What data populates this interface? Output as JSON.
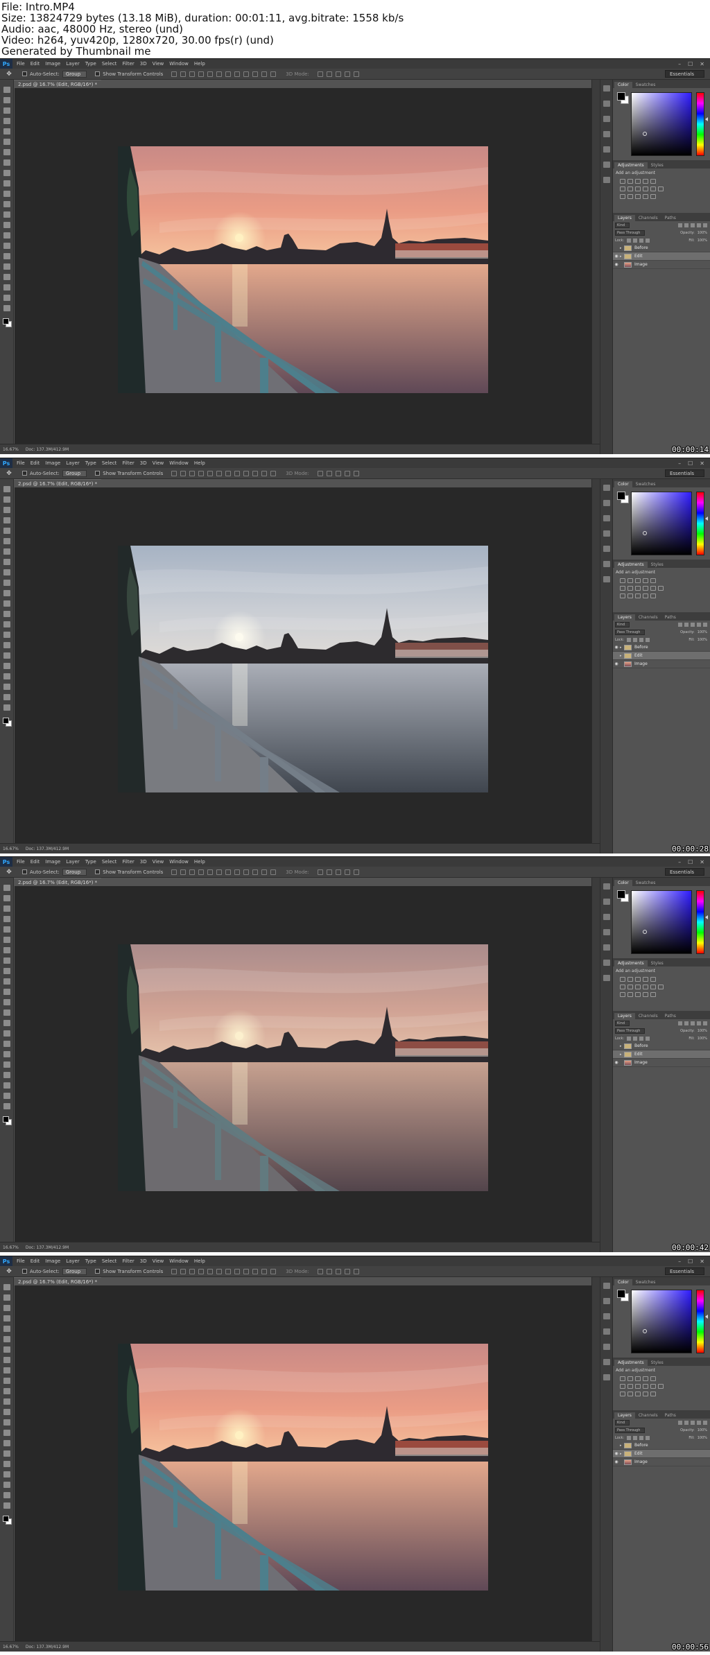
{
  "info": {
    "file_line": "File: Intro.MP4",
    "size_line": "Size: 13824729 bytes (13.18 MiB), duration: 00:01:11, avg.bitrate: 1558 kb/s",
    "audio_line": "Audio: aac, 48000 Hz, stereo (und)",
    "video_line": "Video: h264, yuv420p, 1280x720, 30.00 fps(r) (und)",
    "generator_line": "Generated by Thumbnail me"
  },
  "app": {
    "logo": "Ps",
    "menu": [
      "File",
      "Edit",
      "Image",
      "Layer",
      "Type",
      "Select",
      "Filter",
      "3D",
      "View",
      "Window",
      "Help"
    ],
    "window_buttons": [
      "–",
      "☐",
      "✕"
    ]
  },
  "options_bar": {
    "auto_select_label": "Auto-Select:",
    "auto_select_value": "Group",
    "transform_controls_label": "Show Transform Controls",
    "mode_3d_label": "3D Mode:",
    "workspace": "Essentials"
  },
  "document": {
    "tab_title": "2.psd @ 16.7% (Edit, RGB/16*) *",
    "zoom": "16.67%",
    "doc_size": "Doc: 137.3M/412.9M"
  },
  "panels": {
    "color_tabs": [
      "Color",
      "Swatches"
    ],
    "adjust_tabs": [
      "Adjustments",
      "Styles"
    ],
    "add_adjustment": "Add an adjustment",
    "layers_tabs": [
      "Layers",
      "Channels",
      "Paths"
    ],
    "kind_label": "Kind",
    "blend_mode": "Pass Through",
    "opacity_label": "Opacity:",
    "opacity_value": "100%",
    "lock_label": "Lock:",
    "fill_label": "Fill:",
    "fill_value": "100%"
  },
  "frames": [
    {
      "timestamp": "00:00:14",
      "variant": "warm",
      "photo_saturation": 1.0,
      "layers": [
        {
          "name": "Before",
          "visible": false,
          "selected": false,
          "thumb": "folder",
          "has_arrow": true
        },
        {
          "name": "Edit",
          "visible": true,
          "selected": true,
          "thumb": "folder",
          "has_arrow": true
        },
        {
          "name": "Image",
          "visible": true,
          "selected": false,
          "thumb": "image",
          "has_arrow": false
        }
      ]
    },
    {
      "timestamp": "00:00:28",
      "variant": "cool",
      "photo_saturation": 0.6,
      "layers": [
        {
          "name": "Before",
          "visible": true,
          "selected": false,
          "thumb": "folder",
          "has_arrow": true
        },
        {
          "name": "Edit",
          "visible": false,
          "selected": true,
          "thumb": "folder",
          "has_arrow": true
        },
        {
          "name": "Image",
          "visible": true,
          "selected": false,
          "thumb": "image",
          "has_arrow": false
        }
      ]
    },
    {
      "timestamp": "00:00:42",
      "variant": "muted",
      "photo_saturation": 0.8,
      "layers": [
        {
          "name": "Before",
          "visible": false,
          "selected": false,
          "thumb": "folder",
          "has_arrow": true
        },
        {
          "name": "Edit",
          "visible": false,
          "selected": true,
          "thumb": "folder",
          "has_arrow": true
        },
        {
          "name": "Image",
          "visible": true,
          "selected": false,
          "thumb": "image",
          "has_arrow": false
        }
      ]
    },
    {
      "timestamp": "00:00:56",
      "variant": "warm",
      "photo_saturation": 1.0,
      "layers": [
        {
          "name": "Before",
          "visible": false,
          "selected": false,
          "thumb": "folder",
          "has_arrow": true
        },
        {
          "name": "Edit",
          "visible": true,
          "selected": true,
          "thumb": "folder",
          "has_arrow": true
        },
        {
          "name": "Image",
          "visible": true,
          "selected": false,
          "thumb": "image",
          "has_arrow": false
        }
      ]
    }
  ],
  "palettes": {
    "warm": {
      "sky_top": "#c98a86",
      "sky_mid": "#ea9c85",
      "sky_bottom": "#f7c7a0",
      "water_top": "#e3a88c",
      "water_bottom": "#5f4856",
      "sun": "#fff1c2",
      "rail": "#4d7f8c",
      "walk": "#6f6f75"
    },
    "cool": {
      "sky_top": "#9fb4cf",
      "sky_mid": "#c8ced9",
      "sky_bottom": "#e3dcd2",
      "water_top": "#a7aebe",
      "water_bottom": "#3b4554",
      "sun": "#fffbe8",
      "rail": "#6e7f90",
      "walk": "#777b84"
    },
    "muted": {
      "sky_top": "#b18a8a",
      "sky_mid": "#d9a08e",
      "sky_bottom": "#efc4a6",
      "water_top": "#cf9f8a",
      "water_bottom": "#55434c",
      "sun": "#fff0c6",
      "rail": "#5d7b82",
      "walk": "#6d6b70"
    }
  }
}
